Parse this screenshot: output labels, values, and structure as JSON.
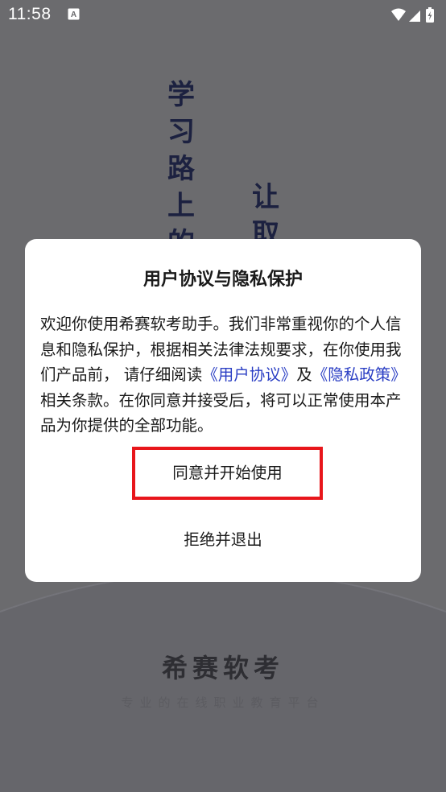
{
  "status_bar": {
    "time": "11:58",
    "notification_icon": "a-box-icon",
    "icons": [
      "wifi-icon",
      "signal-icon",
      "battery-charging-icon"
    ]
  },
  "background": {
    "calligraphy_col1": [
      "学",
      "习",
      "路",
      "上",
      "的"
    ],
    "calligraphy_col2": [
      "让",
      "取"
    ],
    "brand_name": "希赛软考",
    "brand_slogan": "专业的在线职业教育平台"
  },
  "dialog": {
    "title": "用户协议与隐私保护",
    "body_before_link1": "欢迎你使用希赛软考助手。我们非常重视你的个人信息和隐私保护，根据相关法律法规要求，在你使用我们产品前， 请仔细阅读",
    "link_user_agreement": "《用户协议》",
    "body_and": "及",
    "link_privacy_policy": "《隐私政策》",
    "body_after_links": "相关条款。在你同意并接受后，将可以正常使用本产品为你提供的全部功能。",
    "agree_button": "同意并开始使用",
    "refuse_button": "拒绝并退出"
  },
  "colors": {
    "overlay_background": "#6b6b6e",
    "link": "#2b3fc4",
    "highlight_border": "#e8161b"
  }
}
